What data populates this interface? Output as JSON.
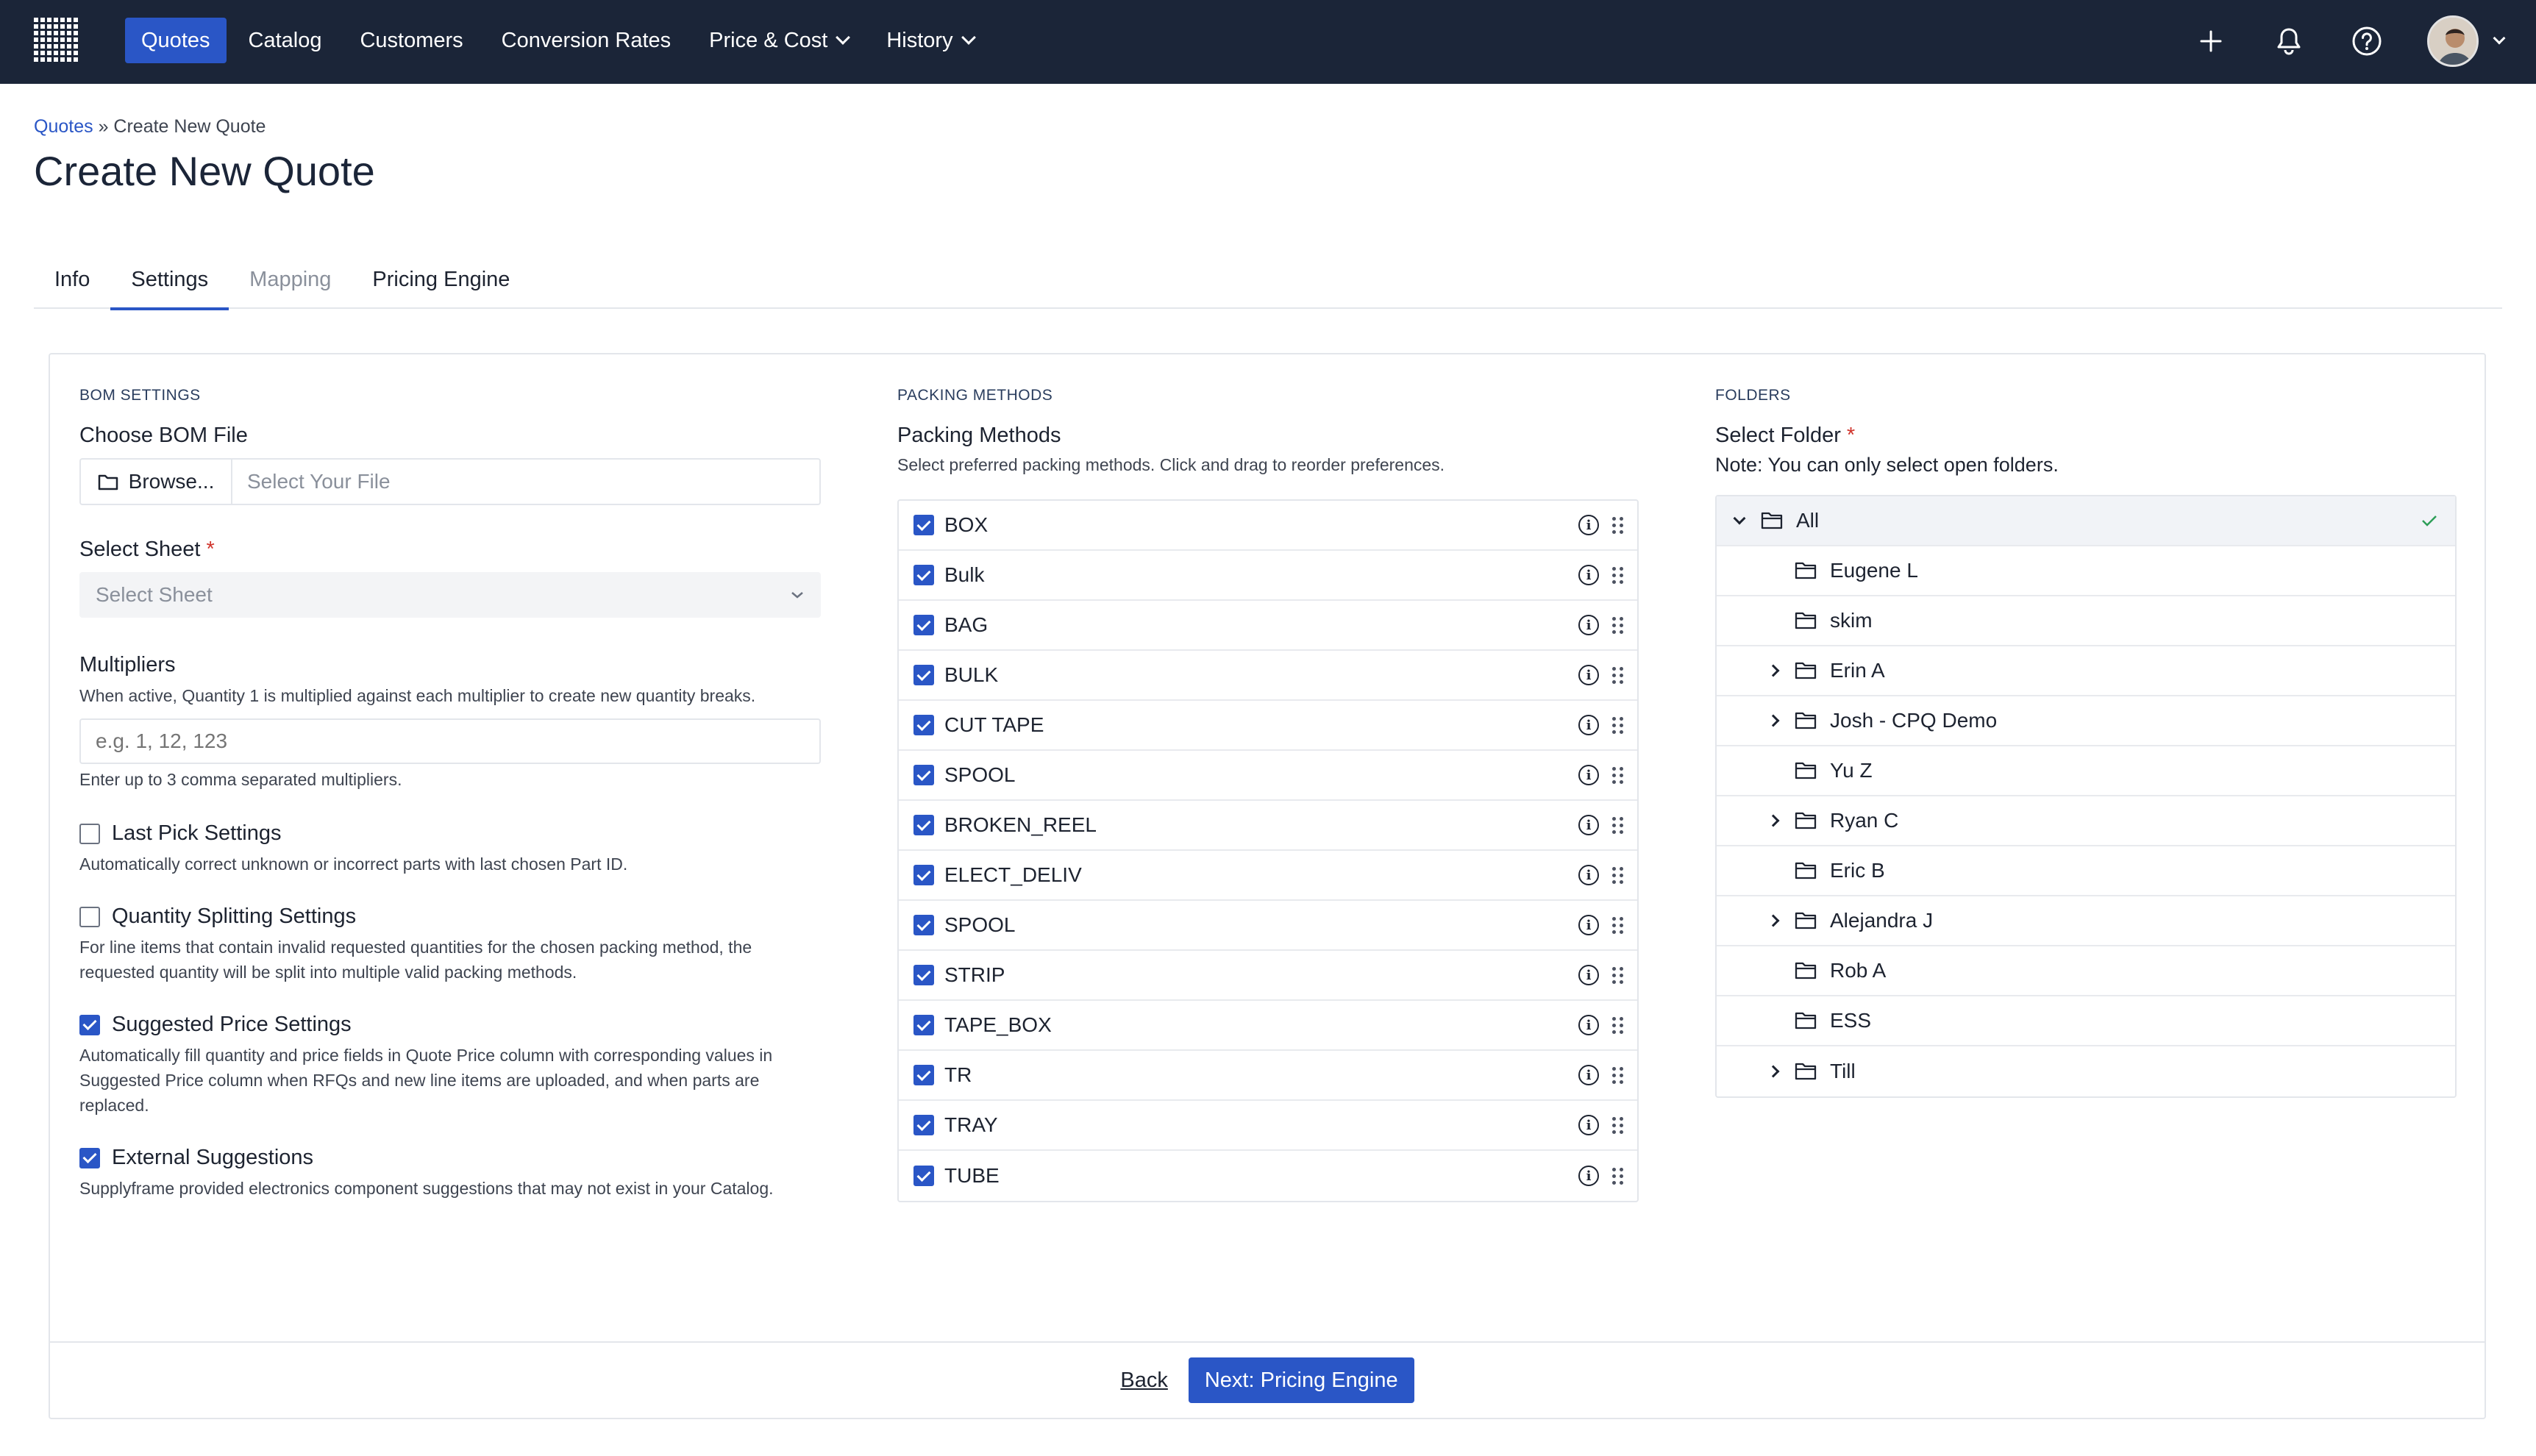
{
  "nav": {
    "items": [
      {
        "label": "Quotes"
      },
      {
        "label": "Catalog"
      },
      {
        "label": "Customers"
      },
      {
        "label": "Conversion Rates"
      },
      {
        "label": "Price & Cost"
      },
      {
        "label": "History"
      }
    ],
    "accent": "#2a56c6",
    "background": "#1b2538"
  },
  "breadcrumb": {
    "parent": "Quotes",
    "separator": "»",
    "current": "Create New Quote"
  },
  "page": {
    "title": "Create New Quote"
  },
  "tabs": [
    {
      "label": "Info"
    },
    {
      "label": "Settings"
    },
    {
      "label": "Mapping"
    },
    {
      "label": "Pricing Engine"
    }
  ],
  "bom": {
    "section": "BOM SETTINGS",
    "file_label": "Choose BOM File",
    "browse_label": "Browse...",
    "file_placeholder": "Select Your File",
    "sheet_label": "Select Sheet",
    "required_mark": "*",
    "sheet_placeholder": "Select Sheet",
    "multipliers_label": "Multipliers",
    "multipliers_help": "When active, Quantity 1 is multiplied against each multiplier to create new quantity breaks.",
    "multipliers_placeholder": "e.g. 1, 12, 123",
    "multipliers_note": "Enter up to 3 comma separated multipliers.",
    "options": [
      {
        "label": "Last Pick Settings",
        "checked": false,
        "help": "Automatically correct unknown or incorrect parts with last chosen Part ID."
      },
      {
        "label": "Quantity Splitting Settings",
        "checked": false,
        "help": "For line items that contain invalid requested quantities for the chosen packing method, the requested quantity will be split into multiple valid packing methods."
      },
      {
        "label": "Suggested Price Settings",
        "checked": true,
        "help": "Automatically fill quantity and price fields in Quote Price column with corresponding values in Suggested Price column when RFQs and new line items are uploaded, and when parts are replaced."
      },
      {
        "label": "External Suggestions",
        "checked": true,
        "help": "Supplyframe provided electronics component suggestions that may not exist in your Catalog."
      }
    ]
  },
  "packing": {
    "section": "PACKING METHODS",
    "label": "Packing Methods",
    "help": "Select preferred packing methods. Click and drag to reorder preferences.",
    "methods": [
      {
        "label": "BOX",
        "checked": true
      },
      {
        "label": "Bulk",
        "checked": true
      },
      {
        "label": "BAG",
        "checked": true
      },
      {
        "label": "BULK",
        "checked": true
      },
      {
        "label": "CUT TAPE",
        "checked": true
      },
      {
        "label": "SPOOL",
        "checked": true
      },
      {
        "label": "BROKEN_REEL",
        "checked": true
      },
      {
        "label": "ELECT_DELIV",
        "checked": true
      },
      {
        "label": "SPOOL",
        "checked": true
      },
      {
        "label": "STRIP",
        "checked": true
      },
      {
        "label": "TAPE_BOX",
        "checked": true
      },
      {
        "label": "TR",
        "checked": true
      },
      {
        "label": "TRAY",
        "checked": true
      },
      {
        "label": "TUBE",
        "checked": true
      }
    ]
  },
  "folders": {
    "section": "FOLDERS",
    "label": "Select Folder",
    "required_mark": "*",
    "note": "Note: You can only select open folders.",
    "items": [
      {
        "label": "All",
        "level": 0,
        "expandable": true,
        "expanded": true,
        "selected": true
      },
      {
        "label": "Eugene L",
        "level": 1,
        "expandable": false
      },
      {
        "label": "skim",
        "level": 1,
        "expandable": false
      },
      {
        "label": "Erin A",
        "level": 1,
        "expandable": true
      },
      {
        "label": "Josh - CPQ Demo",
        "level": 1,
        "expandable": true
      },
      {
        "label": "Yu Z",
        "level": 1,
        "expandable": false
      },
      {
        "label": "Ryan C",
        "level": 1,
        "expandable": true
      },
      {
        "label": "Eric B",
        "level": 1,
        "expandable": false
      },
      {
        "label": "Alejandra J",
        "level": 1,
        "expandable": true
      },
      {
        "label": "Rob A",
        "level": 1,
        "expandable": false
      },
      {
        "label": "ESS",
        "level": 1,
        "expandable": false
      },
      {
        "label": "Till",
        "level": 1,
        "expandable": true
      }
    ]
  },
  "footer": {
    "back_label": "Back",
    "next_label": "Next: Pricing Engine"
  }
}
